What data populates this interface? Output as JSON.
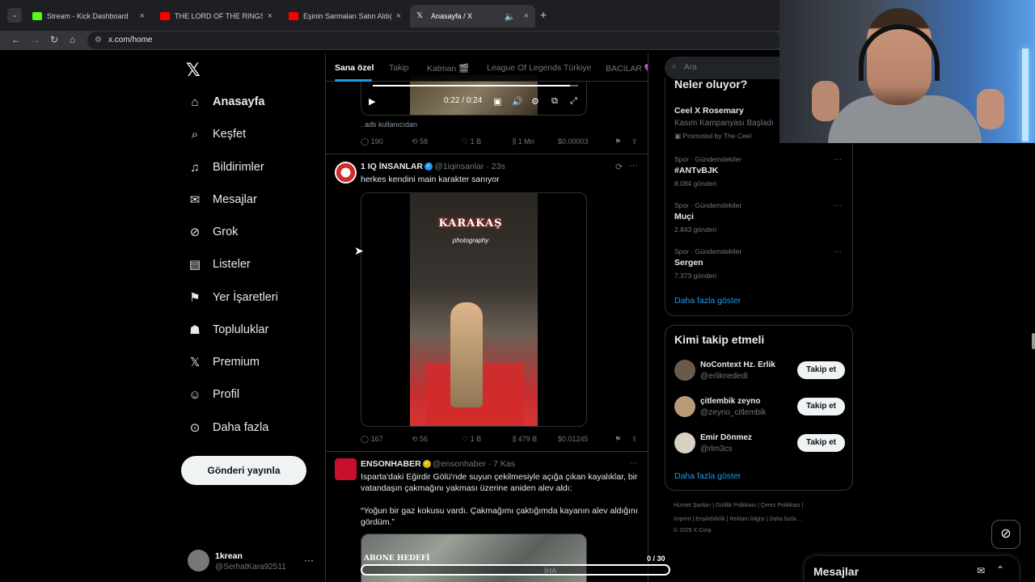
{
  "browser": {
    "tabs": [
      {
        "title": "Stream - Kick Dashboard",
        "favicon_color": "#53fc18"
      },
      {
        "title": "THE LORD OF THE RINGS Symp",
        "favicon_color": "#ff0000"
      },
      {
        "title": "Eşinin Sarmaları Satın Aldığını Ö",
        "favicon_color": "#ff0000"
      },
      {
        "title": "Anasayfa / X",
        "favicon_color": "#ffffff"
      }
    ],
    "url": "x.com/home"
  },
  "sidebar": {
    "logo": "𝕏",
    "items": [
      {
        "label": "Anasayfa",
        "icon": "home-icon"
      },
      {
        "label": "Keşfet",
        "icon": "search-icon"
      },
      {
        "label": "Bildirimler",
        "icon": "bell-icon"
      },
      {
        "label": "Mesajlar",
        "icon": "mail-icon"
      },
      {
        "label": "Grok",
        "icon": "grok-icon"
      },
      {
        "label": "Listeler",
        "icon": "list-icon"
      },
      {
        "label": "Yer İşaretleri",
        "icon": "bookmark-icon"
      },
      {
        "label": "Topluluklar",
        "icon": "communities-icon"
      },
      {
        "label": "Premium",
        "icon": "x-icon"
      },
      {
        "label": "Profil",
        "icon": "profile-icon"
      },
      {
        "label": "Daha fazla",
        "icon": "more-icon"
      }
    ],
    "post_button": "Gönderi yayınla",
    "account": {
      "name": "1krean",
      "handle": "@SerhatKara92511"
    }
  },
  "feed": {
    "tabs": [
      "Sana özel",
      "Takip",
      "Katman 🎬",
      "League Of Legends Türkiye",
      "BACILAR 💜"
    ],
    "video_time": "0:22 / 0:24",
    "credit": "adlı kullanıcıdan",
    "post0_stats": {
      "replies": "190",
      "reposts": "58",
      "likes": "1 B",
      "views": "1 Mn",
      "tip": "$0.00003"
    },
    "post1": {
      "name": "1 IQ İNSANLAR",
      "handle": "@1iqinsanlar",
      "time": "· 23s",
      "text": "herkes kendini main karakter sanıyor",
      "sign": "KARAKAŞ",
      "sign_sub": "photography",
      "stats": {
        "replies": "167",
        "reposts": "56",
        "likes": "1 B",
        "views": "479 B",
        "tip": "$0.01245"
      }
    },
    "post2": {
      "name": "ENSONHABER",
      "handle": "@ensonhaber",
      "time": "· 7 Kas",
      "text": "Isparta'daki Eğirdir Gölü'nde suyun çekilmesiyle açığa çıkan kayalıklar, bir vatandaşın çakmağını yakması üzerine aniden alev aldı:\n\n“Yoğun bir gaz kokusu vardı. Çakmağımı çaktığımda kayanın alev aldığını gördüm.”",
      "watermark": "İHA"
    }
  },
  "right": {
    "search_placeholder": "Ara",
    "trends_title": "Neler oluyor?",
    "promo": {
      "title": "Ceel X Rosemary",
      "sub": "Kasım Kampanyası Başladı",
      "promoted": "Promoted by The Ceel"
    },
    "trends": [
      {
        "context": "Spor · Gündemdekiler",
        "topic": "#ANTvBJK",
        "count": "8.084 gönderi"
      },
      {
        "context": "Spor · Gündemdekiler",
        "topic": "Muçi",
        "count": "2.843 gönderi"
      },
      {
        "context": "Spor · Gündemdekiler",
        "topic": "Sergen",
        "count": "7.373 gönderi"
      }
    ],
    "show_more": "Daha fazla göster",
    "wtf_title": "Kimi takip etmeli",
    "who_to_follow": [
      {
        "name": "NoContext Hz. Erlik",
        "handle": "@erliknededi",
        "color": "#6a5a4a"
      },
      {
        "name": "çitlembik zeyno",
        "handle": "@zeyno_citlembik",
        "color": "#b89a7a"
      },
      {
        "name": "Emir Dönmez",
        "handle": "@rlm3cs",
        "color": "#d8d0c0"
      }
    ],
    "follow_label": "Takip et",
    "footer_line1": "Hizmet Şartları  |  Gizlilik Politikası  |  Çerez Politikası  |",
    "footer_line2": "Imprint  |  Erişilebilirlik  |  Reklam bilgisi  |  Daha fazla ...",
    "footer_line3": "© 2025 X Corp."
  },
  "messages_drawer": {
    "title": "Mesajlar"
  },
  "stream_overlay": {
    "goal_label": "ABONE HEDEFİ",
    "goal_value": "0 / 30"
  }
}
